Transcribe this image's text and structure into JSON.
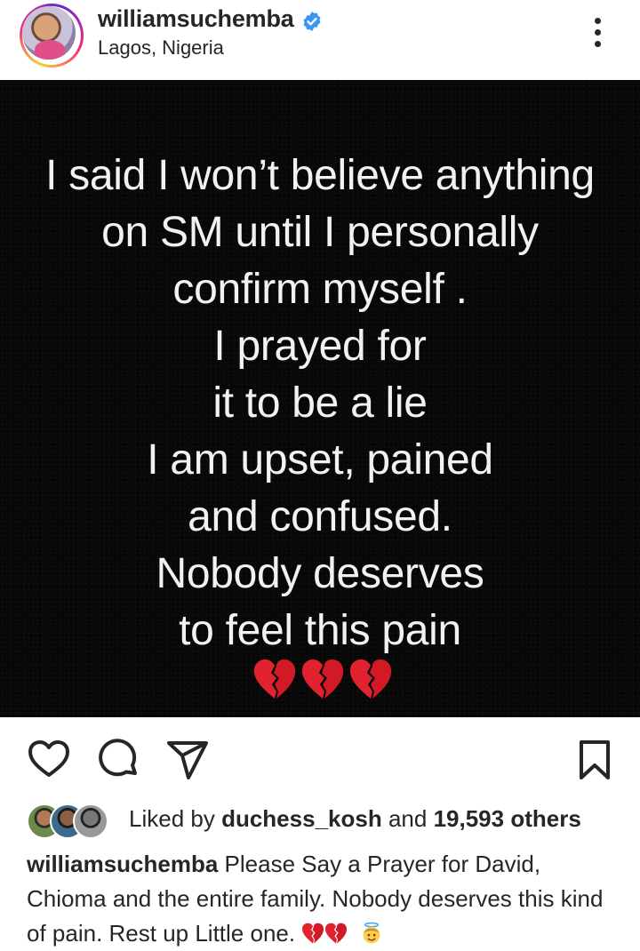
{
  "header": {
    "username": "williamsuchemba",
    "location": "Lagos, Nigeria",
    "verified": true
  },
  "post": {
    "lines": [
      "I said I won’t believe anything",
      "on SM until I personally",
      "confirm myself .",
      "I prayed for",
      "it to be a lie",
      "I am upset, pained",
      "and confused.",
      "Nobody deserves",
      "to feel this pain"
    ],
    "emoji": [
      "broken-heart",
      "broken-heart",
      "broken-heart"
    ],
    "background_color": "#070707",
    "text_color": "#f2f2f2"
  },
  "actions": {
    "like_icon": "heart-outline-icon",
    "comment_icon": "comment-icon",
    "share_icon": "send-icon",
    "save_icon": "bookmark-icon"
  },
  "likes": {
    "prefix": "Liked by",
    "user": "duchess_kosh",
    "joiner": "and",
    "count": "19,593 others"
  },
  "caption": {
    "username": "williamsuchemba",
    "text": "Please Say a Prayer for David, Chioma and the entire family. Nobody deserves this kind of pain. Rest up Little one.",
    "emoji": [
      "broken-heart",
      "broken-heart",
      "angel-face"
    ]
  },
  "colors": {
    "accent_verified": "#3897f0",
    "text": "#262626",
    "broken_heart": "#e0232e"
  }
}
